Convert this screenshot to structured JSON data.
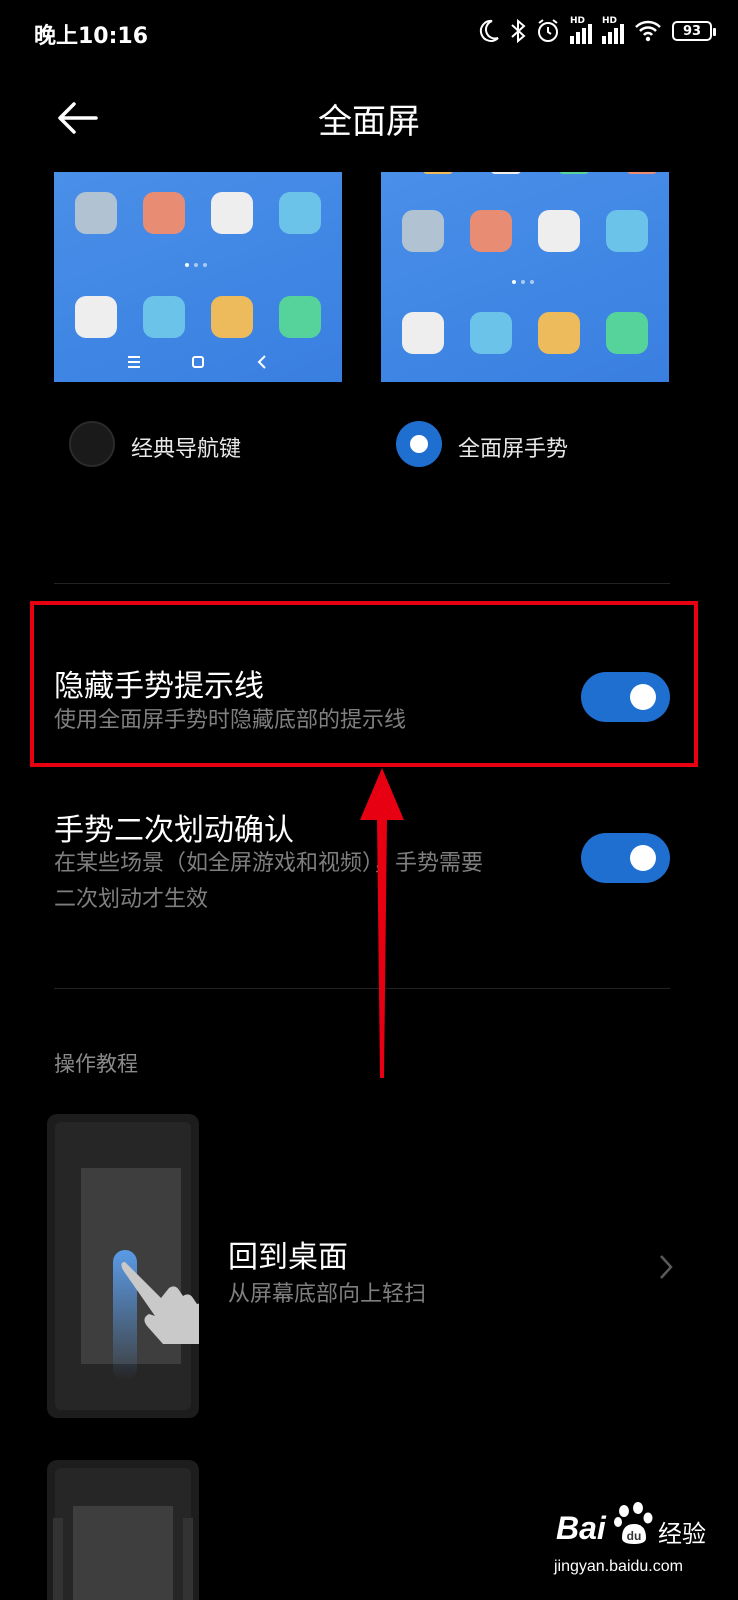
{
  "status_bar": {
    "time": "晚上10:16",
    "signal1_label": "HD",
    "signal2_label": "HD",
    "battery": "93"
  },
  "header": {
    "title": "全面屏"
  },
  "nav_modes": {
    "classic_label": "经典导航键",
    "gesture_label": "全面屏手势",
    "selected": "gesture"
  },
  "settings": {
    "hide_hint_line": {
      "title": "隐藏手势提示线",
      "subtitle": "使用全面屏手势时隐藏底部的提示线",
      "enabled": true
    },
    "double_swipe_confirm": {
      "title": "手势二次划动确认",
      "subtitle_line1": "在某些场景（如全屏游戏和视频），手势需要",
      "subtitle_line2": "二次划动才生效",
      "enabled": true
    }
  },
  "tutorial": {
    "section_label": "操作教程",
    "items": [
      {
        "title": "回到桌面",
        "subtitle": "从屏幕底部向上轻扫"
      }
    ]
  },
  "watermark": {
    "brand": "Bai",
    "brand_suffix": "经验",
    "url": "jingyan.baidu.com"
  },
  "colors": {
    "accent": "#1f6fd0",
    "annotation_red": "#e60012",
    "background": "#000000"
  }
}
